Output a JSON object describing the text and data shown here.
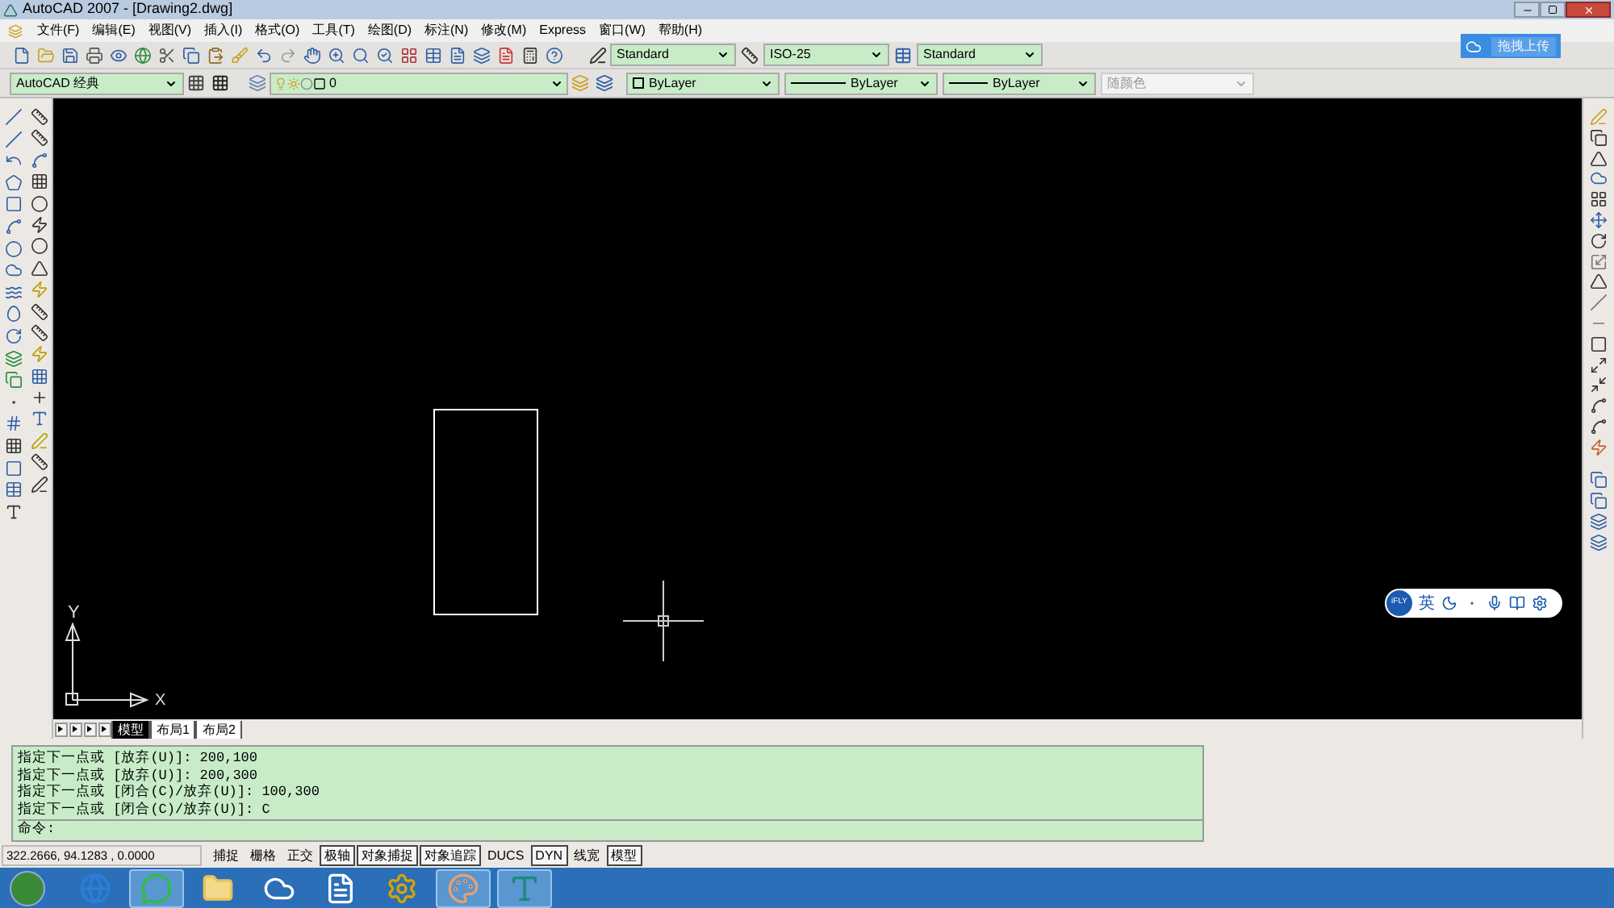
{
  "window": {
    "title": "AutoCAD 2007 - [Drawing2.dwg]"
  },
  "menu": [
    "文件(F)",
    "编辑(E)",
    "视图(V)",
    "插入(I)",
    "格式(O)",
    "工具(T)",
    "绘图(D)",
    "标注(N)",
    "修改(M)",
    "Express",
    "窗口(W)",
    "帮助(H)"
  ],
  "styles": {
    "text_style": "Standard",
    "dim_style": "ISO-25",
    "table_style": "Standard"
  },
  "workspace": "AutoCAD 经典",
  "layer": "0",
  "properties": [
    {
      "value": "ByLayer",
      "kind": "color",
      "disabled": false
    },
    {
      "value": "ByLayer",
      "kind": "linetype",
      "disabled": false
    },
    {
      "value": "ByLayer",
      "kind": "lineweight",
      "disabled": false
    },
    {
      "value": "随颜色",
      "kind": "plotstyle",
      "disabled": true
    }
  ],
  "upload_badge": "拖拽上传",
  "ucs": {
    "x": "X",
    "y": "Y"
  },
  "ime_bar": {
    "logo": "iFLY",
    "mode": "英"
  },
  "layout_tabs": [
    {
      "label": "模型",
      "selected": true
    },
    {
      "label": "布局1",
      "selected": false
    },
    {
      "label": "布局2",
      "selected": false
    }
  ],
  "command_history": [
    "指定下一点或 [放弃(U)]: 200,100",
    "指定下一点或 [放弃(U)]: 200,300",
    "指定下一点或 [闭合(C)/放弃(U)]: 100,300",
    "指定下一点或 [闭合(C)/放弃(U)]: C"
  ],
  "command_prompt": "命令:",
  "status_bar": {
    "coordinates": "322.2666, 94.1283 , 0.0000",
    "toggles": [
      {
        "label": "捕捉",
        "on": false
      },
      {
        "label": "栅格",
        "on": false
      },
      {
        "label": "正交",
        "on": false
      },
      {
        "label": "极轴",
        "on": true
      },
      {
        "label": "对象捕捉",
        "on": true
      },
      {
        "label": "对象追踪",
        "on": true
      },
      {
        "label": "DUCS",
        "on": false
      },
      {
        "label": "DYN",
        "on": true
      },
      {
        "label": "线宽",
        "on": false
      },
      {
        "label": "模型",
        "on": true
      }
    ]
  },
  "taskbar": [
    {
      "kind": "browser",
      "running": false
    },
    {
      "kind": "chat",
      "running": true
    },
    {
      "kind": "folder",
      "running": false
    },
    {
      "kind": "cloud",
      "running": false
    },
    {
      "kind": "writer",
      "running": false
    },
    {
      "kind": "editor",
      "running": false
    },
    {
      "kind": "paint",
      "running": true
    },
    {
      "kind": "cad",
      "running": true
    }
  ]
}
